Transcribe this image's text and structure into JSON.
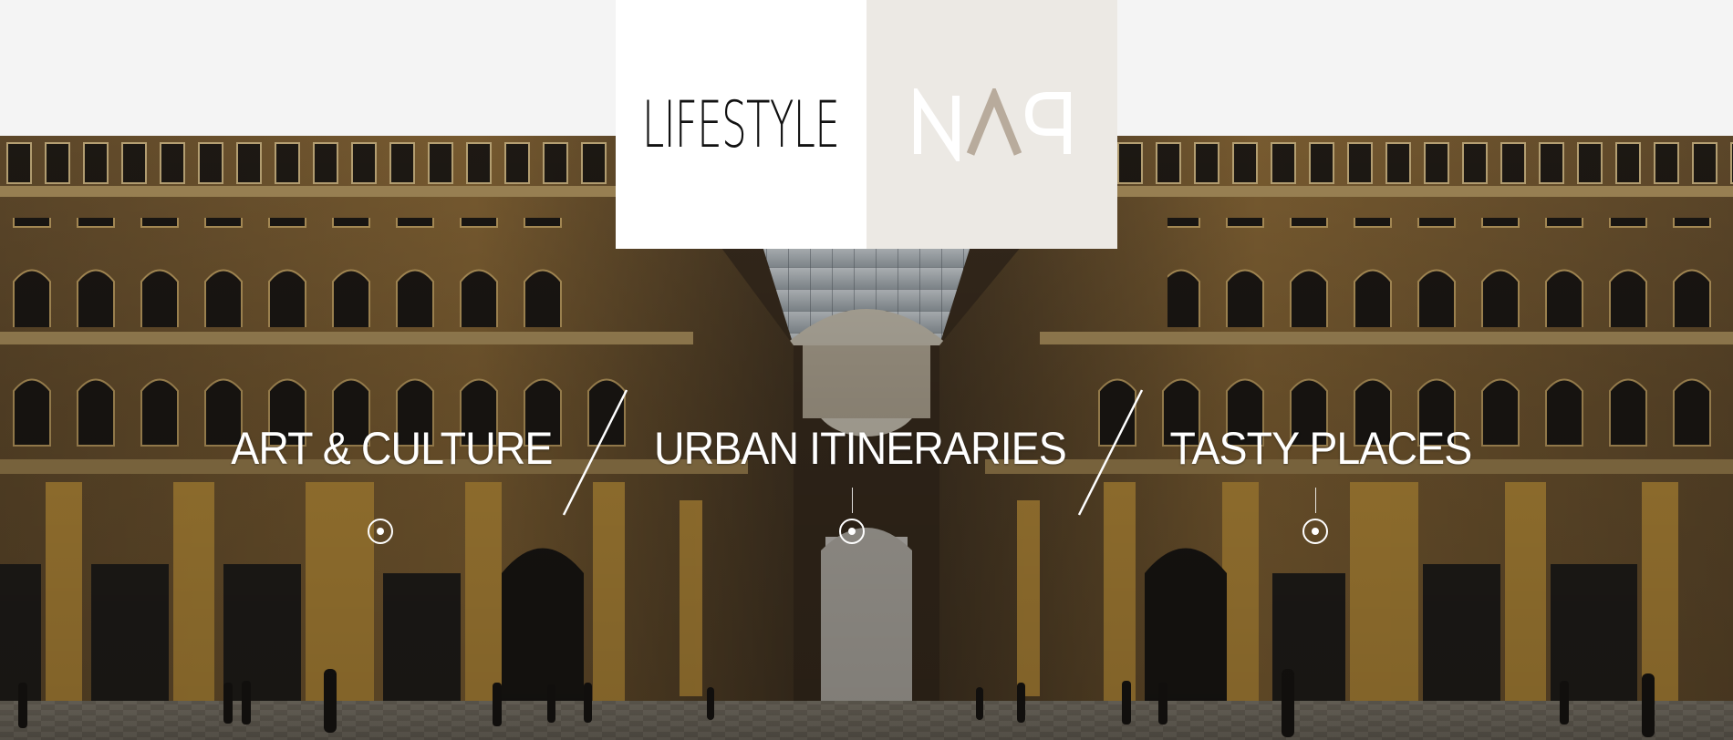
{
  "logo": {
    "left_word": "LIFESTYLE",
    "right_mark_name": "nap-logo-mark",
    "colors": {
      "left_bg": "#ffffff",
      "right_bg": "#ece9e4",
      "mark_white": "#ffffff",
      "mark_taupe": "#b8ab9c"
    }
  },
  "categories": [
    {
      "label": "ART & CULTURE"
    },
    {
      "label": "URBAN ITINERARIES"
    },
    {
      "label": "TASTY PLACES"
    }
  ],
  "hero": {
    "scene": "galleria-arcade-photo",
    "colors": {
      "stone": "#c49a4a",
      "dark": "#2b2218",
      "glass": "#c9d1d6"
    }
  }
}
